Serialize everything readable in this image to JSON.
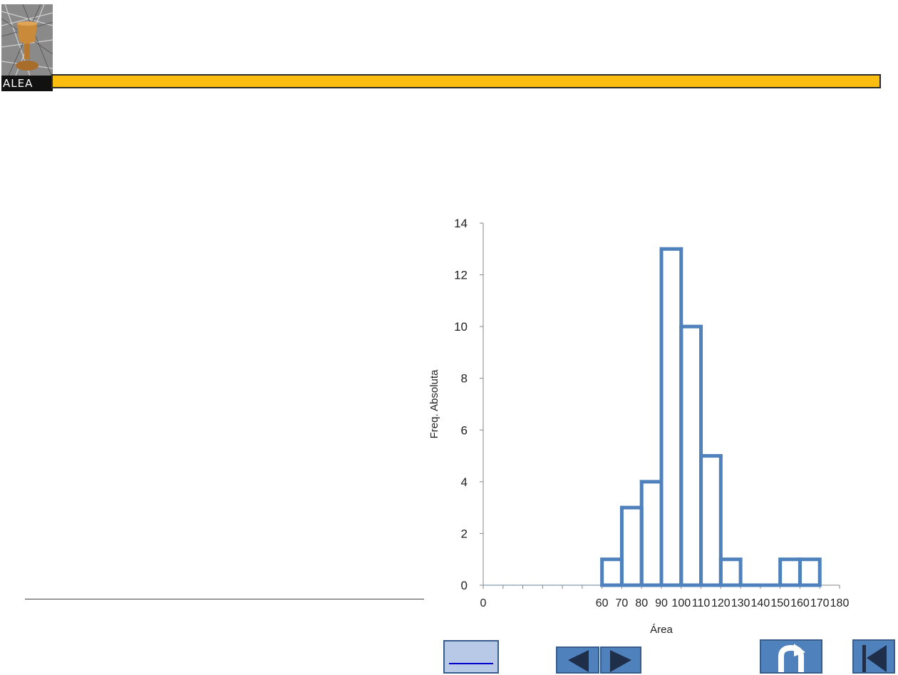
{
  "logo": {
    "caption": "ALEA",
    "icon": "grail-image"
  },
  "header": {
    "bar_color": "#fbbd10"
  },
  "link": {
    "text": ""
  },
  "nav": {
    "prev_icon": "triangle-left-icon",
    "next_icon": "triangle-right-icon",
    "return_icon": "u-turn-icon",
    "first_icon": "skip-to-start-icon",
    "button_color": "#4f81bd"
  },
  "chart_data": {
    "type": "line",
    "title": "",
    "xlabel": "Área",
    "ylabel": "Freq. Absoluta",
    "xlim": [
      0,
      180
    ],
    "ylim": [
      0,
      14
    ],
    "xticks": [
      0,
      10,
      20,
      30,
      40,
      50,
      60,
      70,
      80,
      90,
      100,
      110,
      120,
      130,
      140,
      150,
      160,
      170,
      180
    ],
    "xticklabels": [
      "0",
      "",
      "",
      "",
      "",
      "",
      "60",
      "70",
      "80",
      "90",
      "100",
      "110",
      "120",
      "130",
      "140",
      "150",
      "160",
      "170",
      "180"
    ],
    "yticks": [
      0,
      2,
      4,
      6,
      8,
      10,
      12,
      14
    ],
    "color": "#4f81bd",
    "series": [
      {
        "x": [
          0,
          60,
          60,
          70,
          70,
          80,
          80,
          90,
          90,
          100,
          100,
          110,
          110,
          120,
          120,
          130,
          130,
          140,
          150,
          150,
          160,
          170,
          170
        ],
        "y": [
          0,
          0,
          1,
          1,
          3,
          3,
          4,
          4,
          13,
          13,
          10,
          10,
          5,
          5,
          1,
          1,
          0,
          0,
          0,
          1,
          1,
          1,
          0
        ]
      }
    ],
    "bars": [
      {
        "x0": 60,
        "x1": 70,
        "value": 1
      },
      {
        "x0": 70,
        "x1": 80,
        "value": 3
      },
      {
        "x0": 80,
        "x1": 90,
        "value": 4
      },
      {
        "x0": 90,
        "x1": 100,
        "value": 13
      },
      {
        "x0": 100,
        "x1": 110,
        "value": 10
      },
      {
        "x0": 110,
        "x1": 120,
        "value": 5
      },
      {
        "x0": 120,
        "x1": 130,
        "value": 1
      },
      {
        "x0": 130,
        "x1": 140,
        "value": 0
      },
      {
        "x0": 140,
        "x1": 150,
        "value": 0
      },
      {
        "x0": 150,
        "x1": 160,
        "value": 1
      },
      {
        "x0": 160,
        "x1": 170,
        "value": 1
      }
    ],
    "grid": false
  }
}
